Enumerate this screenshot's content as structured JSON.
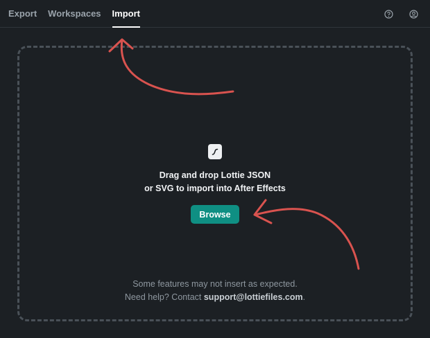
{
  "tabs": [
    {
      "label": "Export",
      "active": false
    },
    {
      "label": "Workspaces",
      "active": false
    },
    {
      "label": "Import",
      "active": true
    }
  ],
  "header_icons": [
    "help-circle-icon",
    "user-circle-icon"
  ],
  "dropzone": {
    "icon": "file-icon",
    "text_line1": "Drag and drop Lottie JSON",
    "text_line2": "or SVG to import into After Effects",
    "browse_label": "Browse"
  },
  "help": {
    "line1": "Some features may not insert as expected.",
    "line2_prefix": "Need help? Contact ",
    "email": "support@lottiefiles.com",
    "line2_suffix": "."
  },
  "colors": {
    "background": "#1c2024",
    "accent": "#0f8f83",
    "annotation_arrow": "#d9534f"
  }
}
